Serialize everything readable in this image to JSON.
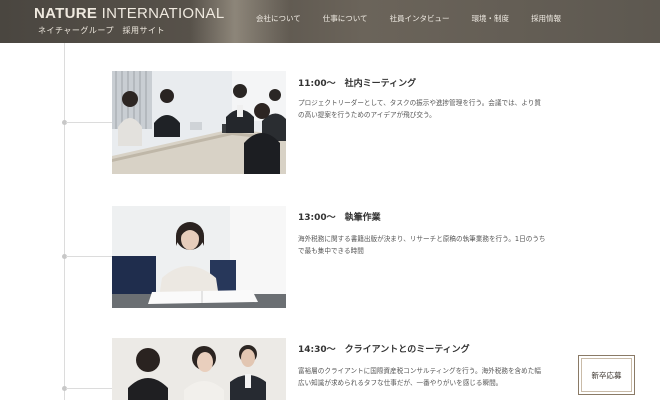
{
  "header": {
    "logo_primary": "NATURE",
    "logo_secondary": "INTERNATIONAL",
    "logo_sub": "ネイチャーグループ　採用サイト",
    "nav": [
      {
        "label": "会社について"
      },
      {
        "label": "仕事について"
      },
      {
        "label": "社員インタビュー"
      },
      {
        "label": "環境・制度"
      },
      {
        "label": "採用情報"
      }
    ]
  },
  "schedule": [
    {
      "title": "11:00～　社内ミーティング",
      "body": "プロジェクトリーダーとして、タスクの振示や進捗管理を行う。会議では、より質の高い提案を行うためのアイデアが飛び交う。",
      "photo": "meeting-room-photo"
    },
    {
      "title": "13:00～　執筆作業",
      "body": "海外税務に関する書籍出版が決まり、リサーチと原稿の執筆業務を行う。1日のうちで最も集中できる時間",
      "photo": "writing-desk-photo"
    },
    {
      "title": "14:30～　クライアントとのミーティング",
      "body": "富裕層のクライアントに国際資産税コンサルティングを行う。海外税務を含めた幅広い知識が求められるタフな仕事だが、一番やりがいを感じる瞬間。",
      "photo": "client-meeting-photo"
    }
  ],
  "cta": {
    "label": "新卒応募"
  },
  "colors": {
    "header_bg": "#55504a",
    "header_text": "#efe9df",
    "cta_border": "#8a7a66",
    "timeline": "#dcdcdc"
  }
}
